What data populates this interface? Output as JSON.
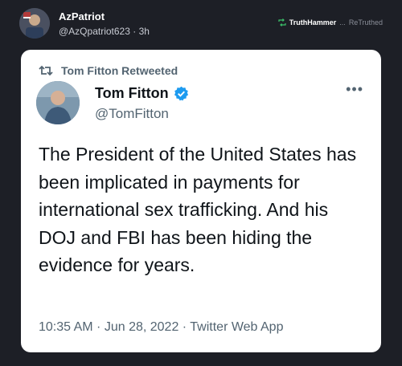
{
  "post": {
    "author_name": "AzPatriot",
    "author_handle": "@AzQpatriot623",
    "time_ago": "3h",
    "retruth_by": "TruthHammer",
    "retruth_label": "ReTruthed",
    "retruth_ellipsis": "...",
    "separator": "·"
  },
  "tweet": {
    "retweet_label": "Tom Fitton Retweeted",
    "name": "Tom Fitton",
    "handle": "@TomFitton",
    "text": "The President of the United States has been implicated in payments for international sex trafficking. And his DOJ and FBI has been hiding the evidence for years.",
    "meta": "10:35 AM · Jun 28, 2022 · Twitter Web App",
    "more": "•••"
  },
  "colors": {
    "page_bg": "#1d1f26",
    "card_bg": "#ffffff",
    "verified_blue": "#1d9bf0",
    "retruth_green": "#3cc46b"
  },
  "icons": [
    "avatar",
    "retruth-icon",
    "retweet-icon",
    "verified-badge-icon",
    "more-options-icon"
  ]
}
